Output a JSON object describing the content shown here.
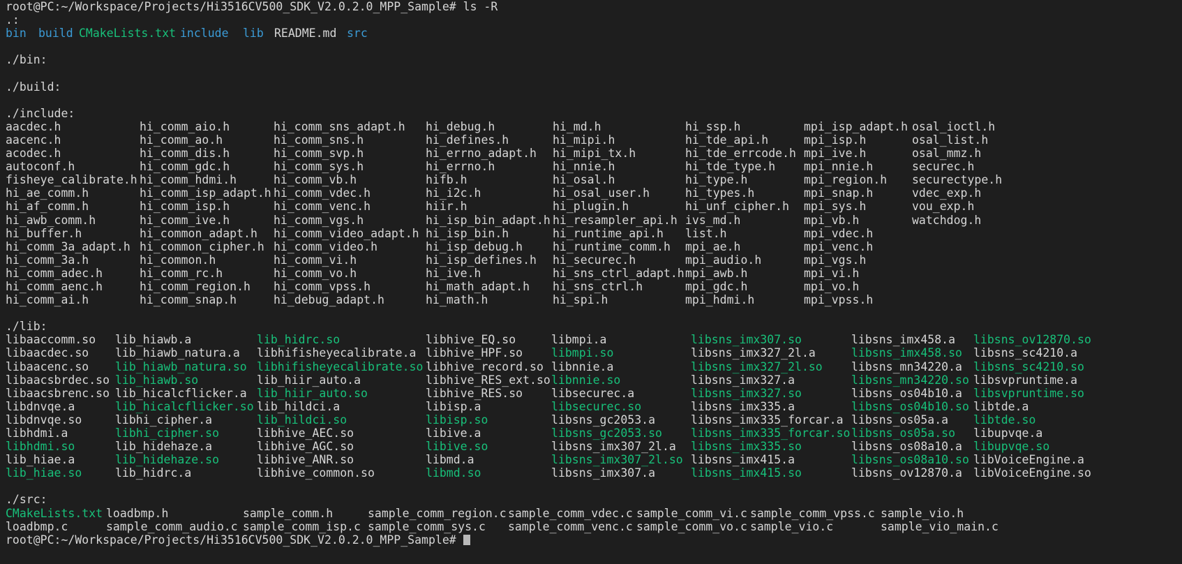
{
  "terminal": {
    "background": "#1e1e1e",
    "foreground": "#d6d6d6",
    "dir_color": "#3b9bd6",
    "exec_color": "#18c07a",
    "prompt": "root@PC:~/Workspace/Projects/Hi3516CV500_SDK_V2.0.2.0_MPP_Sample#",
    "command": "ls -R",
    "prompt_line": "root@PC:~/Workspace/Projects/Hi3516CV500_SDK_V2.0.2.0_MPP_Sample# ls -R",
    "bottom_prompt_partial": "root@PC:~/Workspace/Projects/Hi3516CV500_SDK_V2.0.2.0_MPP_Sample# "
  },
  "sections": [
    {
      "header": ".:",
      "columns": [
        8,
        200,
        392,
        610,
        792,
        982,
        1152,
        1307
      ],
      "rows": [
        [
          {
            "t": "bin",
            "c": "blue"
          },
          {
            "t": "build",
            "c": "blue"
          },
          {
            "t": "CMakeLists.txt",
            "c": "green"
          },
          {
            "t": "include",
            "c": "blue"
          },
          {
            "t": "lib",
            "c": "blue"
          },
          {
            "t": "README.md",
            "c": "white"
          },
          {
            "t": "src",
            "c": "blue"
          }
        ]
      ],
      "inline_columns": [
        8,
        55,
        113,
        258,
        348,
        393,
        497
      ]
    },
    {
      "header": "./bin:",
      "rows": []
    },
    {
      "header": "./build:",
      "rows": []
    },
    {
      "header": "./include:",
      "columns": [
        8,
        200,
        392,
        610,
        792,
        982,
        1152,
        1307
      ],
      "rows": [
        [
          "aacdec.h",
          "hi_comm_aio.h",
          "hi_comm_sns_adapt.h",
          "hi_debug.h",
          "hi_md.h",
          "hi_ssp.h",
          "mpi_isp_adapt.h",
          "osal_ioctl.h"
        ],
        [
          "aacenc.h",
          "hi_comm_ao.h",
          "hi_comm_sns.h",
          "hi_defines.h",
          "hi_mipi.h",
          "hi_tde_api.h",
          "mpi_isp.h",
          "osal_list.h"
        ],
        [
          "acodec.h",
          "hi_comm_dis.h",
          "hi_comm_svp.h",
          "hi_errno_adapt.h",
          "hi_mipi_tx.h",
          "hi_tde_errcode.h",
          "mpi_ive.h",
          "osal_mmz.h"
        ],
        [
          "autoconf.h",
          "hi_comm_gdc.h",
          "hi_comm_sys.h",
          "hi_errno.h",
          "hi_nnie.h",
          "hi_tde_type.h",
          "mpi_nnie.h",
          "securec.h"
        ],
        [
          "fisheye_calibrate.h",
          "hi_comm_hdmi.h",
          "hi_comm_vb.h",
          "hifb.h",
          "hi_osal.h",
          "hi_type.h",
          "mpi_region.h",
          "securectype.h"
        ],
        [
          "hi_ae_comm.h",
          "hi_comm_isp_adapt.h",
          "hi_comm_vdec.h",
          "hi_i2c.h",
          "hi_osal_user.h",
          "hi_types.h",
          "mpi_snap.h",
          "vdec_exp.h"
        ],
        [
          "hi_af_comm.h",
          "hi_comm_isp.h",
          "hi_comm_venc.h",
          "hiir.h",
          "hi_plugin.h",
          "hi_unf_cipher.h",
          "mpi_sys.h",
          "vou_exp.h"
        ],
        [
          "hi_awb_comm.h",
          "hi_comm_ive.h",
          "hi_comm_vgs.h",
          "hi_isp_bin_adapt.h",
          "hi_resampler_api.h",
          "ivs_md.h",
          "mpi_vb.h",
          "watchdog.h"
        ],
        [
          "hi_buffer.h",
          "hi_common_adapt.h",
          "hi_comm_video_adapt.h",
          "hi_isp_bin.h",
          "hi_runtime_api.h",
          "list.h",
          "mpi_vdec.h",
          ""
        ],
        [
          "hi_comm_3a_adapt.h",
          "hi_common_cipher.h",
          "hi_comm_video.h",
          "hi_isp_debug.h",
          "hi_runtime_comm.h",
          "mpi_ae.h",
          "mpi_venc.h",
          ""
        ],
        [
          "hi_comm_3a.h",
          "hi_common.h",
          "hi_comm_vi.h",
          "hi_isp_defines.h",
          "hi_securec.h",
          "mpi_audio.h",
          "mpi_vgs.h",
          ""
        ],
        [
          "hi_comm_adec.h",
          "hi_comm_rc.h",
          "hi_comm_vo.h",
          "hi_ive.h",
          "hi_sns_ctrl_adapt.h",
          "mpi_awb.h",
          "mpi_vi.h",
          ""
        ],
        [
          "hi_comm_aenc.h",
          "hi_comm_region.h",
          "hi_comm_vpss.h",
          "hi_math_adapt.h",
          "hi_sns_ctrl.h",
          "mpi_gdc.h",
          "mpi_vo.h",
          ""
        ],
        [
          "hi_comm_ai.h",
          "hi_comm_snap.h",
          "hi_debug_adapt.h",
          "hi_math.h",
          "hi_spi.h",
          "mpi_hdmi.h",
          "mpi_vpss.h",
          ""
        ]
      ]
    },
    {
      "header": "./lib:",
      "columns": [
        8,
        165,
        368,
        610,
        790,
        990,
        1220,
        1395
      ],
      "rows": [
        [
          {
            "t": "libaaccomm.so",
            "c": "white"
          },
          {
            "t": "lib_hiawb.a",
            "c": "white"
          },
          {
            "t": "lib_hidrc.so",
            "c": "green"
          },
          {
            "t": "libhive_EQ.so",
            "c": "white"
          },
          {
            "t": "libmpi.a",
            "c": "white"
          },
          {
            "t": "libsns_imx307.so",
            "c": "green"
          },
          {
            "t": "libsns_imx458.a",
            "c": "white"
          },
          {
            "t": "libsns_ov12870.so",
            "c": "green"
          }
        ],
        [
          {
            "t": "libaacdec.so",
            "c": "white"
          },
          {
            "t": "lib_hiawb_natura.a",
            "c": "white"
          },
          {
            "t": "libhifisheyecalibrate.a",
            "c": "white"
          },
          {
            "t": "libhive_HPF.so",
            "c": "white"
          },
          {
            "t": "libmpi.so",
            "c": "green"
          },
          {
            "t": "libsns_imx327_2l.a",
            "c": "white"
          },
          {
            "t": "libsns_imx458.so",
            "c": "green"
          },
          {
            "t": "libsns_sc4210.a",
            "c": "white"
          }
        ],
        [
          {
            "t": "libaacenc.so",
            "c": "white"
          },
          {
            "t": "lib_hiawb_natura.so",
            "c": "green"
          },
          {
            "t": "libhifisheyecalibrate.so",
            "c": "green"
          },
          {
            "t": "libhive_record.so",
            "c": "white"
          },
          {
            "t": "libnnie.a",
            "c": "white"
          },
          {
            "t": "libsns_imx327_2l.so",
            "c": "green"
          },
          {
            "t": "libsns_mn34220.a",
            "c": "white"
          },
          {
            "t": "libsns_sc4210.so",
            "c": "green"
          }
        ],
        [
          {
            "t": "libaacsbrdec.so",
            "c": "white"
          },
          {
            "t": "lib_hiawb.so",
            "c": "green"
          },
          {
            "t": "lib_hiir_auto.a",
            "c": "white"
          },
          {
            "t": "libhive_RES_ext.so",
            "c": "white"
          },
          {
            "t": "libnnie.so",
            "c": "green"
          },
          {
            "t": "libsns_imx327.a",
            "c": "white"
          },
          {
            "t": "libsns_mn34220.so",
            "c": "green"
          },
          {
            "t": "libsvpruntime.a",
            "c": "white"
          }
        ],
        [
          {
            "t": "libaacsbrenc.so",
            "c": "white"
          },
          {
            "t": "lib_hicalcflicker.a",
            "c": "white"
          },
          {
            "t": "lib_hiir_auto.so",
            "c": "green"
          },
          {
            "t": "libhive_RES.so",
            "c": "white"
          },
          {
            "t": "libsecurec.a",
            "c": "white"
          },
          {
            "t": "libsns_imx327.so",
            "c": "green"
          },
          {
            "t": "libsns_os04b10.a",
            "c": "white"
          },
          {
            "t": "libsvpruntime.so",
            "c": "green"
          }
        ],
        [
          {
            "t": "libdnvqe.a",
            "c": "white"
          },
          {
            "t": "lib_hicalcflicker.so",
            "c": "green"
          },
          {
            "t": "lib_hildci.a",
            "c": "white"
          },
          {
            "t": "libisp.a",
            "c": "white"
          },
          {
            "t": "libsecurec.so",
            "c": "green"
          },
          {
            "t": "libsns_imx335.a",
            "c": "white"
          },
          {
            "t": "libsns_os04b10.so",
            "c": "green"
          },
          {
            "t": "libtde.a",
            "c": "white"
          }
        ],
        [
          {
            "t": "libdnvqe.so",
            "c": "white"
          },
          {
            "t": "libhi_cipher.a",
            "c": "white"
          },
          {
            "t": "lib_hildci.so",
            "c": "green"
          },
          {
            "t": "libisp.so",
            "c": "green"
          },
          {
            "t": "libsns_gc2053.a",
            "c": "white"
          },
          {
            "t": "libsns_imx335_forcar.a",
            "c": "white"
          },
          {
            "t": "libsns_os05a.a",
            "c": "white"
          },
          {
            "t": "libtde.so",
            "c": "green"
          }
        ],
        [
          {
            "t": "libhdmi.a",
            "c": "white"
          },
          {
            "t": "libhi_cipher.so",
            "c": "green"
          },
          {
            "t": "libhive_AEC.so",
            "c": "white"
          },
          {
            "t": "libive.a",
            "c": "white"
          },
          {
            "t": "libsns_gc2053.so",
            "c": "green"
          },
          {
            "t": "libsns_imx335_forcar.so",
            "c": "green"
          },
          {
            "t": "libsns_os05a.so",
            "c": "green"
          },
          {
            "t": "libupvqe.a",
            "c": "white"
          }
        ],
        [
          {
            "t": "libhdmi.so",
            "c": "green"
          },
          {
            "t": "lib_hidehaze.a",
            "c": "white"
          },
          {
            "t": "libhive_AGC.so",
            "c": "white"
          },
          {
            "t": "libive.so",
            "c": "green"
          },
          {
            "t": "libsns_imx307_2l.a",
            "c": "white"
          },
          {
            "t": "libsns_imx335.so",
            "c": "green"
          },
          {
            "t": "libsns_os08a10.a",
            "c": "white"
          },
          {
            "t": "libupvqe.so",
            "c": "green"
          }
        ],
        [
          {
            "t": "lib_hiae.a",
            "c": "white"
          },
          {
            "t": "lib_hidehaze.so",
            "c": "green"
          },
          {
            "t": "libhive_ANR.so",
            "c": "white"
          },
          {
            "t": "libmd.a",
            "c": "white"
          },
          {
            "t": "libsns_imx307_2l.so",
            "c": "green"
          },
          {
            "t": "libsns_imx415.a",
            "c": "white"
          },
          {
            "t": "libsns_os08a10.so",
            "c": "green"
          },
          {
            "t": "libVoiceEngine.a",
            "c": "white"
          }
        ],
        [
          {
            "t": "lib_hiae.so",
            "c": "green"
          },
          {
            "t": "lib_hidrc.a",
            "c": "white"
          },
          {
            "t": "libhive_common.so",
            "c": "white"
          },
          {
            "t": "libmd.so",
            "c": "green"
          },
          {
            "t": "libsns_imx307.a",
            "c": "white"
          },
          {
            "t": "libsns_imx415.so",
            "c": "green"
          },
          {
            "t": "libsns_ov12870.a",
            "c": "white"
          },
          {
            "t": "libVoiceEngine.so",
            "c": "white"
          }
        ]
      ]
    },
    {
      "header": "./src:",
      "columns": [
        8,
        152,
        348,
        527,
        728,
        912,
        1075,
        1262
      ],
      "rows": [
        [
          {
            "t": "CMakeLists.txt",
            "c": "green"
          },
          {
            "t": "loadbmp.h",
            "c": "white"
          },
          {
            "t": "sample_comm.h",
            "c": "white"
          },
          {
            "t": "sample_comm_region.c",
            "c": "white"
          },
          {
            "t": "sample_comm_vdec.c",
            "c": "white"
          },
          {
            "t": "sample_comm_vi.c",
            "c": "white"
          },
          {
            "t": "sample_comm_vpss.c",
            "c": "white"
          },
          {
            "t": "sample_vio.h",
            "c": "white"
          }
        ],
        [
          {
            "t": "loadbmp.c",
            "c": "white"
          },
          {
            "t": "sample_comm_audio.c",
            "c": "white"
          },
          {
            "t": "sample_comm_isp.c",
            "c": "white"
          },
          {
            "t": "sample_comm_sys.c",
            "c": "white"
          },
          {
            "t": "sample_comm_venc.c",
            "c": "white"
          },
          {
            "t": "sample_comm_vo.c",
            "c": "white"
          },
          {
            "t": "sample_vio.c",
            "c": "white"
          },
          {
            "t": "sample_vio_main.c",
            "c": "white"
          }
        ]
      ]
    }
  ]
}
